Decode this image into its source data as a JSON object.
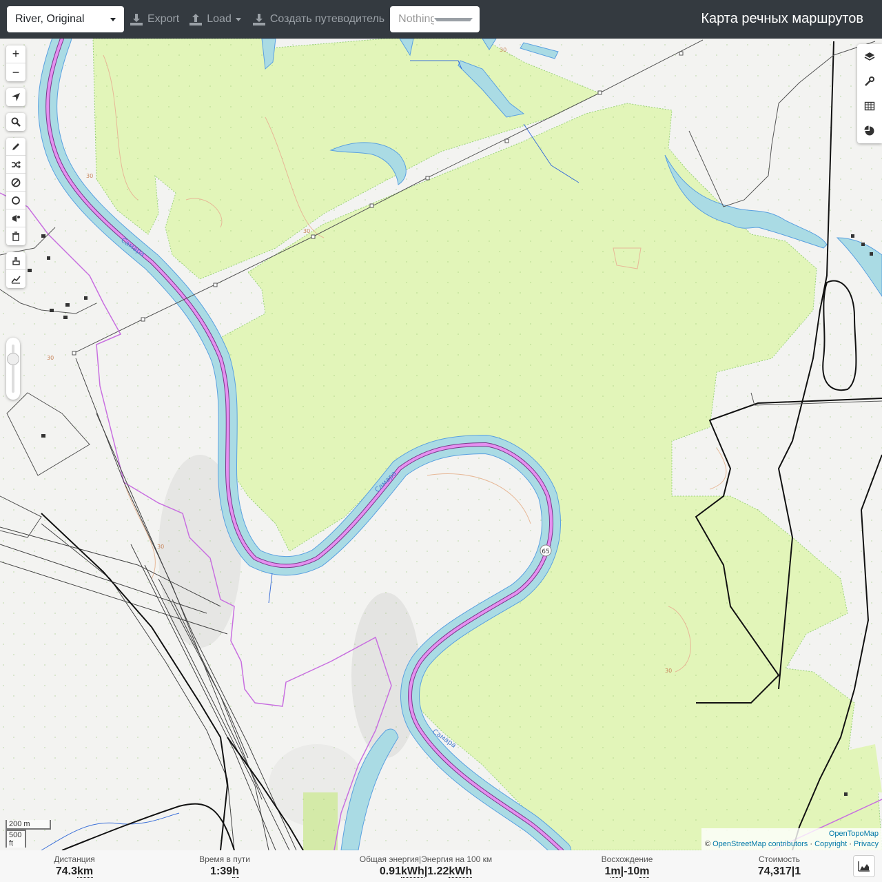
{
  "toolbar": {
    "profile_value": "River, Original",
    "export_label": "Export",
    "load_label": "Load",
    "guide_label": "Создать путеводитель",
    "selection_value": "Nothing selected",
    "brand": "Карта речных маршрутов"
  },
  "zoom_controls": {
    "zoom_in": "+",
    "zoom_out": "−"
  },
  "map": {
    "river_label": "Самара",
    "route_marker": "65",
    "contour_labels": [
      "30",
      "30",
      "30",
      "30",
      "30",
      "30"
    ],
    "colors": {
      "forest": "#e2f5b9",
      "river": "#aadbe4",
      "route": "#e07de8",
      "boundary": "#b65ad6"
    }
  },
  "scale": {
    "metric": "200 m",
    "imperial": "500 ft"
  },
  "attribution": {
    "layer": "OpenTopoMap",
    "copyright_prefix": "©",
    "osm": "OpenStreetMap contributors",
    "copyright": "Copyright",
    "privacy": "Privacy"
  },
  "stats": {
    "distance_label": "Дистанция",
    "distance_value": "74.3",
    "distance_unit": "km",
    "time_label": "Время в пути",
    "time_value": "1:39",
    "time_unit": "h",
    "energy_label": "Общая энергия|Энергия на 100 км",
    "energy_total": "0.91",
    "energy_total_unit": "kWh",
    "energy_sep": "|",
    "energy_per100": "1.22",
    "energy_per100_unit": "kWh",
    "ascent_label": "Восхождение",
    "ascent_up": "1",
    "ascent_up_unit": "m",
    "ascent_sep": "|",
    "ascent_down": "-10",
    "ascent_down_unit": "m",
    "cost_label": "Стоимость",
    "cost_value": "74,317",
    "cost_sep": "|",
    "cost_count": "1"
  }
}
